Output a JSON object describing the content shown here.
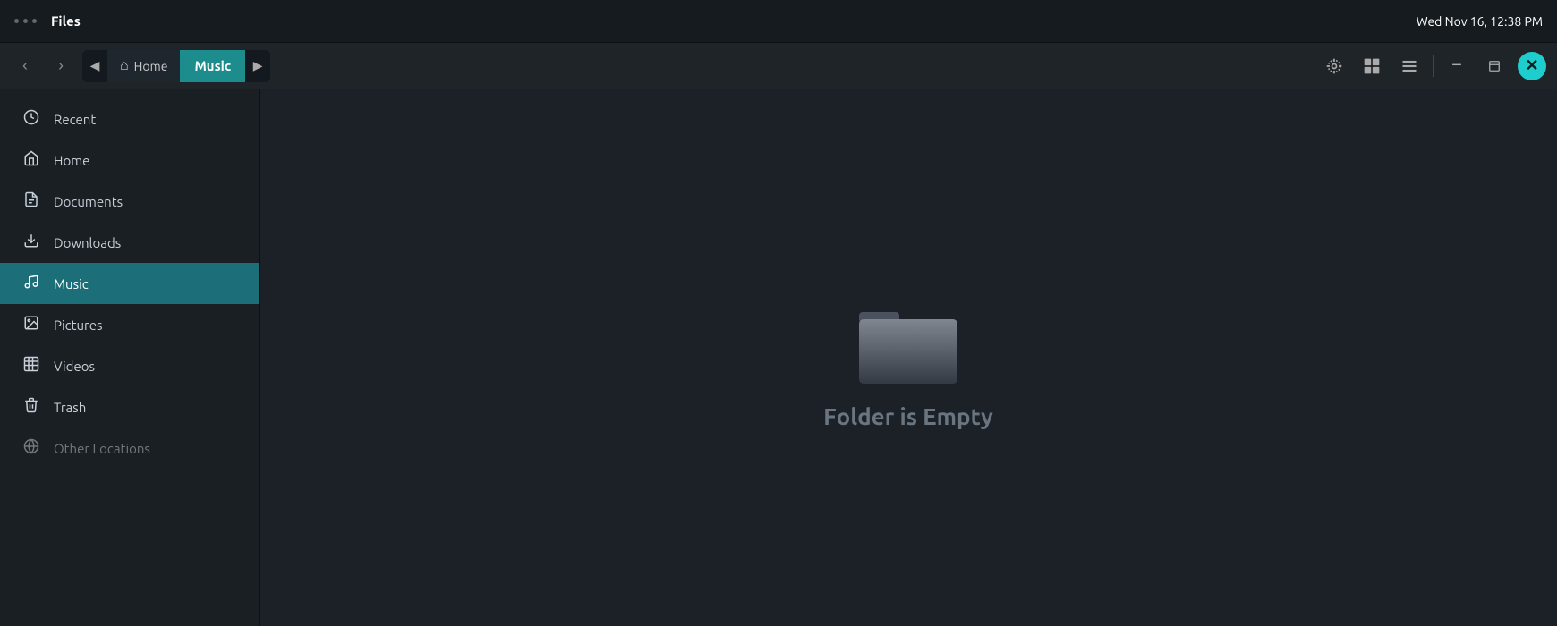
{
  "titlebar": {
    "dots_label": "menu",
    "app_title": "Files",
    "clock": "Wed Nov 16, 12:38 PM"
  },
  "toolbar": {
    "back_label": "‹",
    "forward_label": "›",
    "breadcrumb_back": "◀",
    "breadcrumb_home_icon": "⌂",
    "breadcrumb_home_label": "Home",
    "breadcrumb_active_label": "Music",
    "breadcrumb_forward": "▶",
    "locate_icon": "⊕",
    "grid_icon": "⋯",
    "list_icon": "≡",
    "minimize_label": "−",
    "maximize_label": "❐",
    "close_label": "✕"
  },
  "sidebar": {
    "items": [
      {
        "id": "recent",
        "icon": "🕐",
        "label": "Recent"
      },
      {
        "id": "home",
        "icon": "⌂",
        "label": "Home"
      },
      {
        "id": "documents",
        "icon": "📄",
        "label": "Documents"
      },
      {
        "id": "downloads",
        "icon": "⬇",
        "label": "Downloads"
      },
      {
        "id": "music",
        "icon": "♪",
        "label": "Music"
      },
      {
        "id": "pictures",
        "icon": "🖼",
        "label": "Pictures"
      },
      {
        "id": "videos",
        "icon": "▦",
        "label": "Videos"
      },
      {
        "id": "trash",
        "icon": "🗑",
        "label": "Trash"
      },
      {
        "id": "other-locations",
        "icon": "⊕",
        "label": "Other Locations"
      }
    ]
  },
  "content": {
    "empty_folder_text": "Folder is Empty"
  }
}
